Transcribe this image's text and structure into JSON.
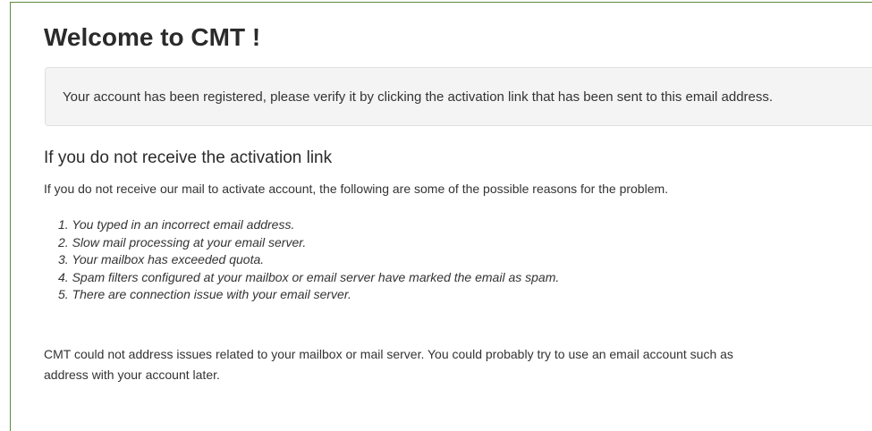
{
  "page": {
    "title": "Welcome to CMT !"
  },
  "alert": {
    "message": "Your account has been registered, please verify it by clicking the activation link that has been sent to this email address."
  },
  "help": {
    "heading": "If you do not receive the activation link",
    "intro": "If you do not receive our mail to activate account, the following are some of the possible reasons for the problem.",
    "reasons": [
      {
        "num": "1.",
        "text": "You typed in an incorrect email address."
      },
      {
        "num": "2.",
        "text": "Slow mail processing at your email server."
      },
      {
        "num": "3.",
        "text": "Your mailbox has exceeded quota."
      },
      {
        "num": "4.",
        "text": "Spam filters configured at your mailbox or email server have marked the email as spam."
      },
      {
        "num": "5.",
        "text": "There are connection issue with your email server."
      }
    ],
    "footer_line1": "CMT could not address issues related to your mailbox or mail server. You could probably try to use an email account such as",
    "footer_line2": "address with your account later."
  },
  "colors": {
    "frame_border": "#5b8c3a",
    "alert_background": "#f4f4f4",
    "text": "#333333"
  }
}
